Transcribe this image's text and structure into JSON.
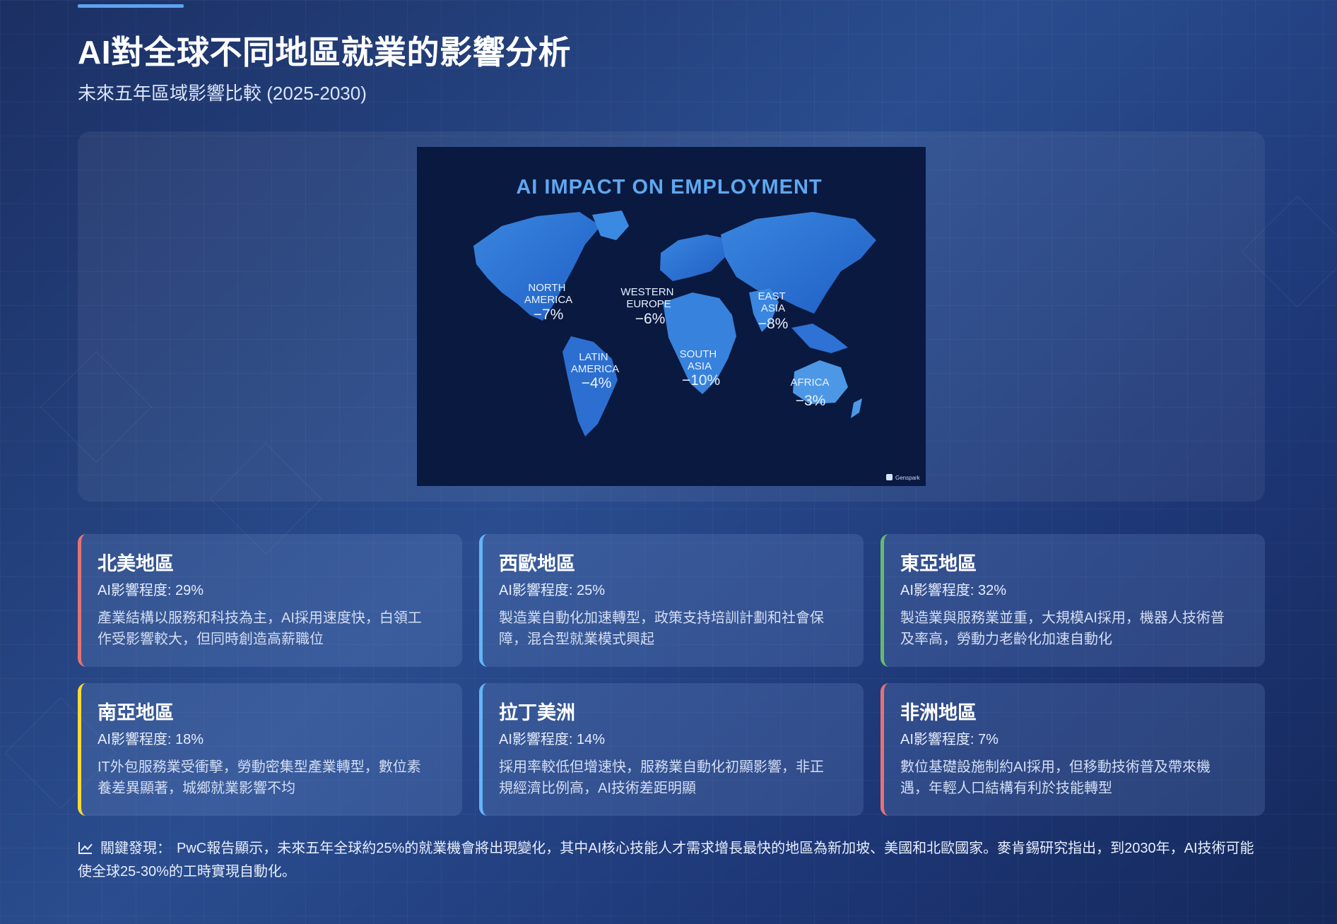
{
  "header": {
    "title": "AI對全球不同地區就業的影響分析",
    "subtitle": "未來五年區域影響比較 (2025-2030)"
  },
  "map": {
    "title": "AI IMPACT ON EMPLOYMENT",
    "watermark": "Genspark",
    "regions": [
      {
        "name_line1": "NORTH",
        "name_line2": "AMERICA",
        "value": "−7%"
      },
      {
        "name_line1": "WESTERN",
        "name_line2": "EUROPE",
        "value": "−6%"
      },
      {
        "name_line1": "EAST",
        "name_line2": "ASIA",
        "value": "−8%"
      },
      {
        "name_line1": "LATIN",
        "name_line2": "AMERICA",
        "value": "−4%"
      },
      {
        "name_line1": "SOUTH",
        "name_line2": "ASIA",
        "value": "−10%"
      },
      {
        "name_line1": "AFRICA",
        "name_line2": "",
        "value": "−3%"
      }
    ]
  },
  "cards": [
    {
      "title": "北美地區",
      "impact": "AI影響程度: 29%",
      "desc_line1": "產業結構以服務和科技為主，AI採用速度快，白領工",
      "desc_line2": "作受影響較大，但同時創造高薪職位",
      "accent": "#e57373"
    },
    {
      "title": "西歐地區",
      "impact": "AI影響程度: 25%",
      "desc_line1": "製造業自動化加速轉型，政策支持培訓計劃和社會保",
      "desc_line2": "障，混合型就業模式興起",
      "accent": "#64b5f6"
    },
    {
      "title": "東亞地區",
      "impact": "AI影響程度: 32%",
      "desc_line1": "製造業與服務業並重，大規模AI採用，機器人技術普",
      "desc_line2": "及率高，勞動力老齡化加速自動化",
      "accent": "#66bb6a"
    },
    {
      "title": "南亞地區",
      "impact": "AI影響程度: 18%",
      "desc_line1": "IT外包服務業受衝擊，勞動密集型產業轉型，數位素",
      "desc_line2": "養差異顯著，城鄉就業影響不均",
      "accent": "#fdd835"
    },
    {
      "title": "拉丁美洲",
      "impact": "AI影響程度: 14%",
      "desc_line1": "採用率較低但增速快，服務業自動化初顯影響，非正",
      "desc_line2": "規經濟比例高，AI技術差距明顯",
      "accent": "#64b5f6"
    },
    {
      "title": "非洲地區",
      "impact": "AI影響程度: 7%",
      "desc_line1": "數位基礎設施制約AI採用，但移動技術普及帶來機",
      "desc_line2": "遇，年輕人口結構有利於技能轉型",
      "accent": "#e57373"
    }
  ],
  "findings": {
    "label": "關鍵發現：",
    "text": "PwC報告顯示，未來五年全球約25%的就業機會將出現變化，其中AI核心技能人才需求增長最快的地區為新加坡、美國和北歐國家。麥肯錫研究指出，到2030年，AI技術可能使全球25-30%的工時實現自動化。"
  },
  "colors": {
    "accent": "#5aa4f0",
    "map_bg": "#0b1a42",
    "map_title": "#5fa8f0"
  }
}
